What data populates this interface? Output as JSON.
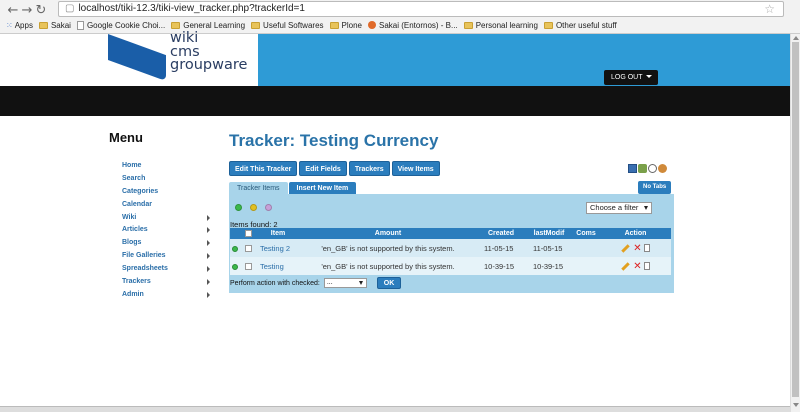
{
  "browser": {
    "url": "localhost/tiki-12.3/tiki-view_tracker.php?trackerId=1",
    "bookmarks": [
      {
        "label": "Apps",
        "kind": "apps"
      },
      {
        "label": "Sakai",
        "kind": "folder"
      },
      {
        "label": "Google Cookie Choi...",
        "kind": "page"
      },
      {
        "label": "General Learning",
        "kind": "folder"
      },
      {
        "label": "Useful Softwares",
        "kind": "folder"
      },
      {
        "label": "Plone",
        "kind": "folder"
      },
      {
        "label": "Sakai (Entornos) - B...",
        "kind": "sakai"
      },
      {
        "label": "Personal learning",
        "kind": "folder"
      },
      {
        "label": "Other useful stuff",
        "kind": "folder"
      }
    ]
  },
  "header": {
    "logo_line1": "wiki",
    "logo_line2": "cms",
    "logo_line3": "groupware",
    "logout_label": "LOG OUT",
    "colors": {
      "band": "#2e9bd6",
      "logo": "#1a5ea8",
      "dark": "#111111"
    }
  },
  "menu": {
    "title": "Menu",
    "items": [
      {
        "label": "Home",
        "arrow": false
      },
      {
        "label": "Search",
        "arrow": false
      },
      {
        "label": "Categories",
        "arrow": false
      },
      {
        "label": "Calendar",
        "arrow": false
      },
      {
        "label": "Wiki",
        "arrow": true
      },
      {
        "label": "Articles",
        "arrow": true
      },
      {
        "label": "Blogs",
        "arrow": true
      },
      {
        "label": "File Galleries",
        "arrow": true
      },
      {
        "label": "Spreadsheets",
        "arrow": true
      },
      {
        "label": "Trackers",
        "arrow": true
      },
      {
        "label": "Admin",
        "arrow": true
      }
    ]
  },
  "main": {
    "title": "Tracker: Testing Currency",
    "buttons": [
      "Edit This Tracker",
      "Edit Fields",
      "Trackers",
      "View Items"
    ],
    "tabs": [
      "Tracker Items",
      "Insert New Item"
    ],
    "no_tabs_label": "No Tabs",
    "filter_label": "Choose a filter",
    "items_found": "Items found: 2",
    "columns": [
      "Item",
      "Amount",
      "Created",
      "lastModif",
      "Coms",
      "Action"
    ],
    "rows": [
      {
        "item": "Testing 2",
        "amount": "'en_GB' is not supported by this system.",
        "created": "11-05-15",
        "modified": "11-05-15",
        "coms": ""
      },
      {
        "item": "Testing",
        "amount": "'en_GB' is not supported by this system.",
        "created": "10-39-15",
        "modified": "10-39-15",
        "coms": ""
      }
    ],
    "perform_label": "Perform action with checked:",
    "perform_option": "...",
    "ok_label": "OK"
  }
}
